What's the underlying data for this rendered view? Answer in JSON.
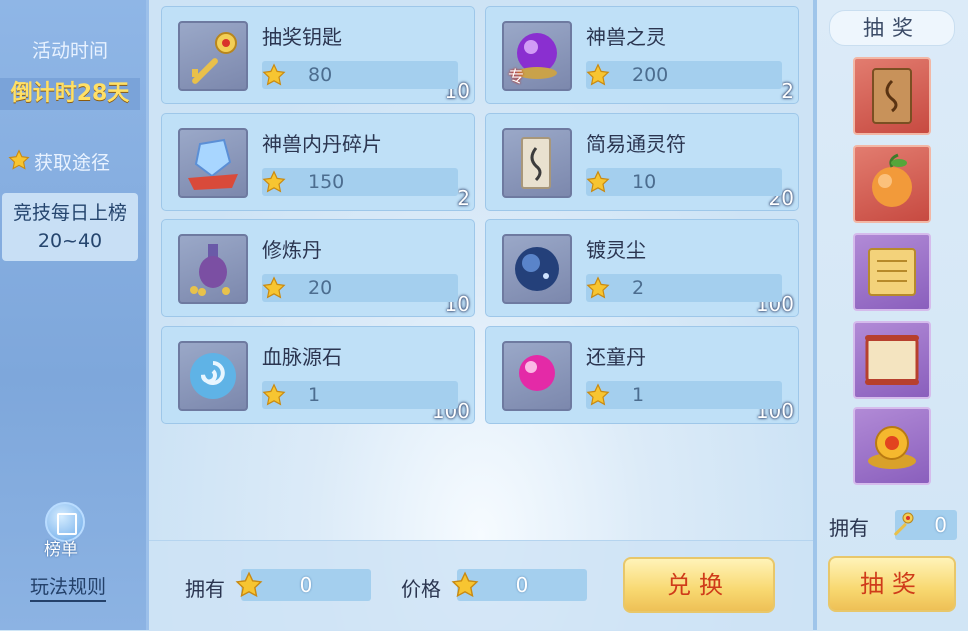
{
  "left": {
    "time_title": "活动时间",
    "countdown": "倒计时28天",
    "acquire_title": "获取途径",
    "acquire_item_line1": "竞技每日上榜",
    "acquire_item_line2": "20~40",
    "rank_label": "榜单",
    "rules_label": "玩法规则"
  },
  "items": [
    {
      "name": "抽奖钥匙",
      "count": "10",
      "price": "80",
      "icon": "golden-key-icon"
    },
    {
      "name": "神兽之灵",
      "count": "2",
      "price": "200",
      "icon": "purple-orb-icon",
      "tag": "专"
    },
    {
      "name": "神兽内丹碎片",
      "count": "2",
      "price": "150",
      "icon": "crystal-shard-icon"
    },
    {
      "name": "简易通灵符",
      "count": "20",
      "price": "10",
      "icon": "talisman-icon"
    },
    {
      "name": "修炼丹",
      "count": "10",
      "price": "20",
      "icon": "vase-icon"
    },
    {
      "name": "镀灵尘",
      "count": "100",
      "price": "2",
      "icon": "dust-orb-icon"
    },
    {
      "name": "血脉源石",
      "count": "100",
      "price": "1",
      "icon": "swirl-stone-icon"
    },
    {
      "name": "还童丹",
      "count": "100",
      "price": "1",
      "icon": "pink-pill-icon"
    }
  ],
  "bottom": {
    "own_label": "拥有",
    "own_value": "0",
    "price_label": "价格",
    "price_value": "0",
    "exchange_label": "兑换"
  },
  "right": {
    "title": "抽奖",
    "own_label": "拥有",
    "own_value": "0",
    "draw_label": "抽奖",
    "prizes": [
      "talisman-scroll-icon",
      "peach-icon",
      "golden-scroll-icon",
      "red-scroll-icon",
      "golden-treasure-icon"
    ]
  },
  "colors": {
    "accent_gold": "#f8d870",
    "button_text": "#cf3b1a",
    "countdown": "#ffe066"
  }
}
